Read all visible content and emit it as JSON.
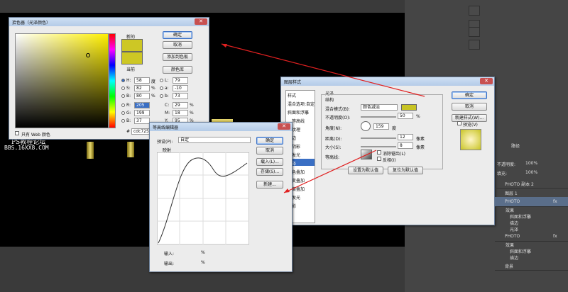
{
  "picker": {
    "title": "拾色器（光泽颜色）",
    "ok": "确定",
    "cancel": "取消",
    "add_swatch": "添加到色板",
    "color_libs": "颜色库",
    "new_label": "新的",
    "current_label": "当前",
    "only_web": "只有 Web 颜色",
    "H": "58",
    "S": "82",
    "B": "80",
    "R": "205",
    "G": "199",
    "B2": "37",
    "L": "79",
    "a": "-10",
    "b": "73",
    "C": "29",
    "M": "18",
    "Y": "95",
    "K": "0",
    "hex": "cdc725",
    "deg": "度",
    "pct1": "%",
    "pct2": "%",
    "pct3": "%",
    "pct4": "%",
    "pct5": "%",
    "pct6": "%",
    "labels": {
      "H": "H:",
      "S": "S:",
      "Bv": "B:",
      "R": "R:",
      "G": "G:",
      "B": "B:",
      "L": "L:",
      "a": "a:",
      "b": "b:",
      "C": "C:",
      "M": "M:",
      "Y": "Y:",
      "K": "K:",
      "hash": "#"
    },
    "new_color": "#cdc725",
    "current_color": "#cdc725"
  },
  "watermark": {
    "line1": "PS教程论坛",
    "line2": "BBS.16XX8.COM"
  },
  "curve": {
    "title": "等高线编辑器",
    "preset_label": "预设(P):",
    "preset_value": "自定",
    "mapping": "映射",
    "ok": "确定",
    "cancel": "取消",
    "load": "载入(L)...",
    "save": "存储(S)...",
    "new": "新建...",
    "input": "输入:",
    "output": "输出:",
    "in_pct": "%",
    "out_pct": "%"
  },
  "layer_style": {
    "title": "图层样式",
    "styles_header": "样式",
    "blend_opts": "混合选项:自定",
    "items": [
      "斜面和浮雕",
      "等高线",
      "纹理",
      "描边",
      "内阴影",
      "内发光",
      "光泽",
      "颜色叠加",
      "渐变叠加",
      "图案叠加",
      "外发光",
      "投影"
    ],
    "section": "光泽",
    "structure": "结构",
    "blend_mode_label": "混合模式(B):",
    "blend_mode": "颜色减淡",
    "opacity_label": "不透明度(O):",
    "opacity": "50",
    "opacity_unit": "%",
    "angle_label": "角度(N):",
    "angle": "159",
    "angle_unit": "度",
    "distance_label": "距离(D):",
    "distance": "12",
    "distance_unit": "像素",
    "size_label": "大小(S):",
    "size": "8",
    "size_unit": "像素",
    "contour_label": "等高线:",
    "antialias": "消除锯齿(L)",
    "invert": "反相(I)",
    "set_default": "设置为默认值",
    "reset_default": "复位为默认值",
    "ok": "确定",
    "cancel": "取消",
    "new_style": "新建样式(W)...",
    "preview": "预览(V)",
    "swatch": "#c8c424"
  },
  "layers": {
    "tab1": "路径",
    "layer_top": "PHOTO 副本 2",
    "layer1": "图层 1",
    "photo": "PHOTO",
    "effects": "效果",
    "bevel": "斜面和浮雕",
    "stroke": "描边",
    "satin": "光泽",
    "photo2": "PHOTO",
    "effects2": "效果",
    "bevel2": "斜面和浮雕",
    "stroke2": "描边",
    "bg": "背景",
    "fx": "fx",
    "opacity_label": "不透明度:",
    "opacity_val": "100%",
    "fill_label": "填充:",
    "fill_val": "100%"
  }
}
